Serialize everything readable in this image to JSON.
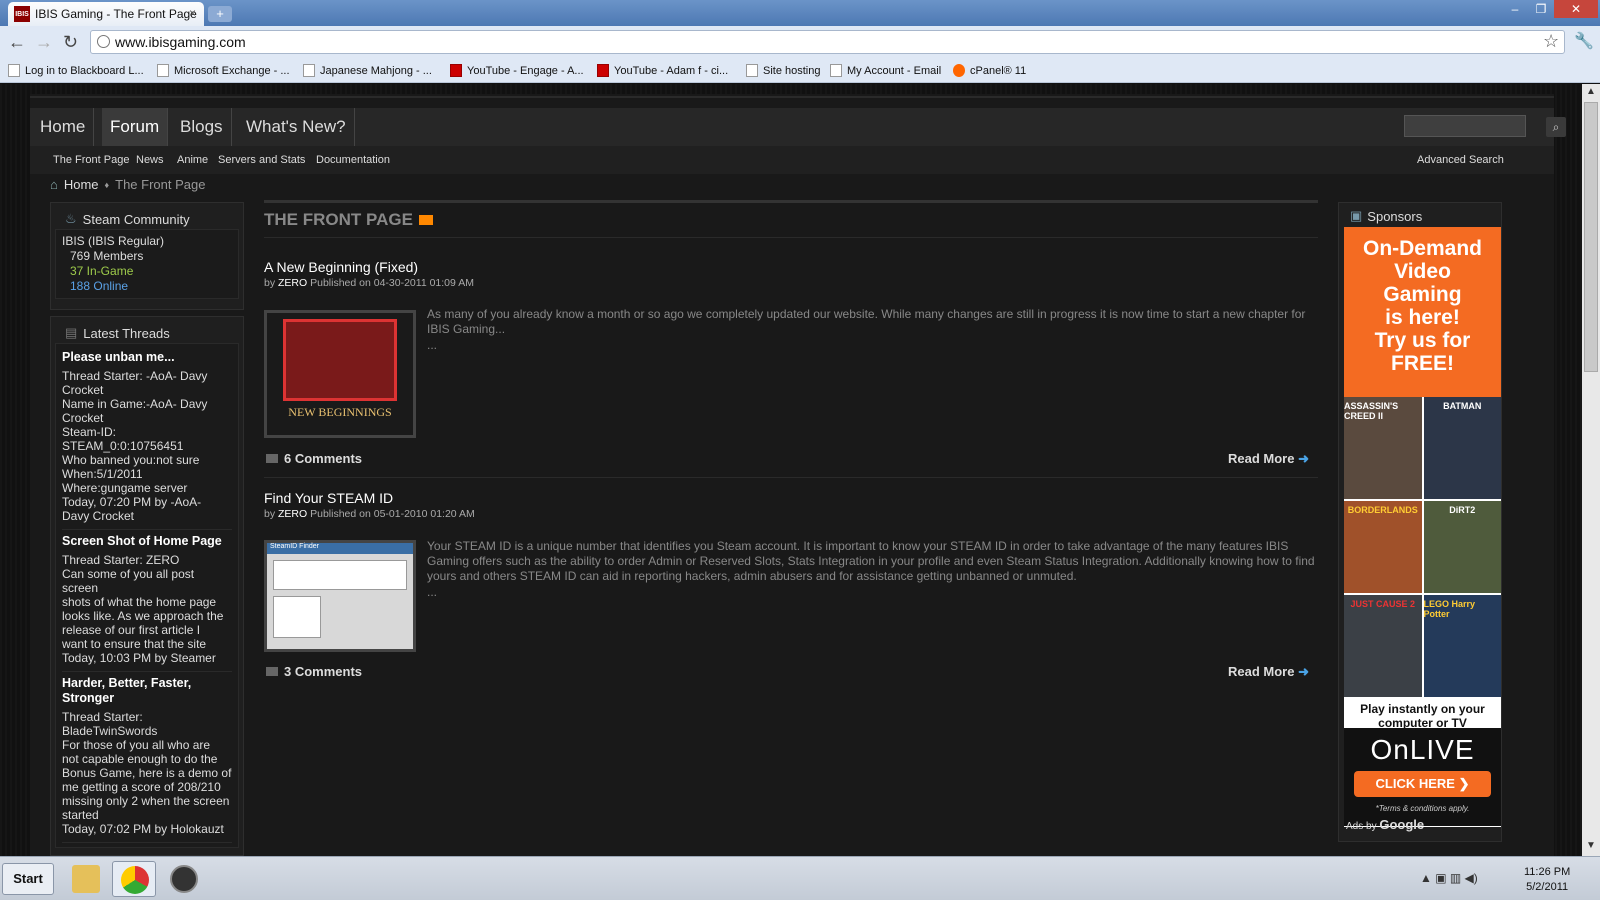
{
  "browser": {
    "tab_title": "IBIS Gaming - The Front Page",
    "favicon_text": "IBIS",
    "tab_close": "×",
    "new_tab": "+",
    "win_min": "–",
    "win_max": "❐",
    "win_close": "✕",
    "back": "←",
    "forward": "→",
    "reload": "↻",
    "url": "www.ibisgaming.com",
    "star": "☆",
    "wrench": "🔧",
    "bookmarks": [
      {
        "label": "Log in to Blackboard L..."
      },
      {
        "label": "Microsoft Exchange - ..."
      },
      {
        "label": "Japanese Mahjong - ..."
      },
      {
        "label": "YouTube - Engage - A..."
      },
      {
        "label": "YouTube - Adam f - ci..."
      },
      {
        "label": "Site hosting"
      },
      {
        "label": "My Account - Email"
      },
      {
        "label": "cPanel® 11"
      }
    ]
  },
  "nav": {
    "tabs": [
      "Home",
      "Forum",
      "Blogs",
      "What's New?"
    ],
    "search_icon": "⌕",
    "sub": [
      "The Front Page",
      "News",
      "Anime",
      "Servers and Stats",
      "Documentation"
    ],
    "advanced_search": "Advanced Search"
  },
  "breadcrumb": {
    "home": "Home",
    "current": "The Front Page",
    "sep": "♦"
  },
  "steam": {
    "title": "Steam Community",
    "group": "IBIS (IBIS Regular)",
    "members": "769 Members",
    "ingame": "37 In-Game",
    "online": "188 Online"
  },
  "threads": {
    "title": "Latest Threads",
    "items": [
      {
        "title": "Please unban me...",
        "body": "Thread Starter: -AoA- Davy\nCrocket\nName in Game:-AoA- Davy\nCrocket\nSteam-ID:\nSTEAM_0:0:10756451\nWho banned you:not sure\nWhen:5/1/2011\nWhere:gungame server",
        "when": "Today, 07:20 PM by -AoA-\nDavy Crocket"
      },
      {
        "title": "Screen Shot of Home Page",
        "body": "Thread Starter: ZERO\nCan some of you all post screen\nshots of what the home page\nlooks like. As we approach the\nrelease of our first article I\nwant to ensure that the site",
        "when": "Today, 10:03 PM by Steamer"
      },
      {
        "title": "Harder, Better, Faster,\nStronger",
        "body": "Thread Starter:\nBladeTwinSwords\nFor those of you all who are\nnot capable enough to do the\nBonus Game, here is a demo of\nme getting a score of 208/210\nmissing only 2 when the screen\nstarted",
        "when": "Today, 07:02 PM by Holokauzt"
      }
    ]
  },
  "frontpage": {
    "title": "THE FRONT PAGE",
    "articles": [
      {
        "title": "A New Beginning (Fixed)",
        "author": "ZERO",
        "published": "Published on 04-30-2011 01:09 AM",
        "by": "by",
        "text": "As many of you already know a month or so ago we completely updated our website. While many changes are still in progress it is now time to start a new chapter for IBIS Gaming...",
        "ellipsis": "...",
        "thumb_caption": "NEW BEGINNINGS",
        "comments": "6 Comments",
        "readmore": "Read More"
      },
      {
        "title": "Find Your STEAM ID",
        "author": "ZERO",
        "published": "Published on 05-01-2010 01:20 AM",
        "by": "by",
        "text": "Your STEAM ID is a unique number that identifies you Steam account. It is important to know your STEAM ID in order to take advantage of the many features IBIS Gaming offers such as the ability to order Admin or Reserved Slots, Stats Integration in your profile and even Steam Status Integration. Additionally knowing how to find yours and others STEAM ID can aid in reporting hackers, admin abusers and for assistance getting unbanned or unmuted.",
        "ellipsis": "...",
        "thumb_caption": "SteamID Finder",
        "comments": "3 Comments",
        "readmore": "Read More"
      }
    ]
  },
  "sponsors": {
    "title": "Sponsors",
    "ad_headline": "On-Demand\nVideo\nGaming\nis here!\nTry us for\nFREE!",
    "games": [
      "ASSASSIN'S CREED II",
      "BATMAN",
      "BORDERLANDS",
      "DiRT2",
      "JUST CAUSE 2",
      "LEGO Harry Potter"
    ],
    "play_text": "Play instantly on your\ncomputer or TV",
    "logo": "OnLIVE",
    "click": "CLICK HERE ❯",
    "terms": "*Terms & conditions apply.",
    "ads_by": "Ads by",
    "google": "Google"
  },
  "taskbar": {
    "start": "Start",
    "time": "11:26 PM",
    "date": "5/2/2011"
  },
  "colors": {
    "accent_orange": "#f46b22",
    "link_blue": "#5aa1e6",
    "ingame_green": "#9ecb4b"
  }
}
